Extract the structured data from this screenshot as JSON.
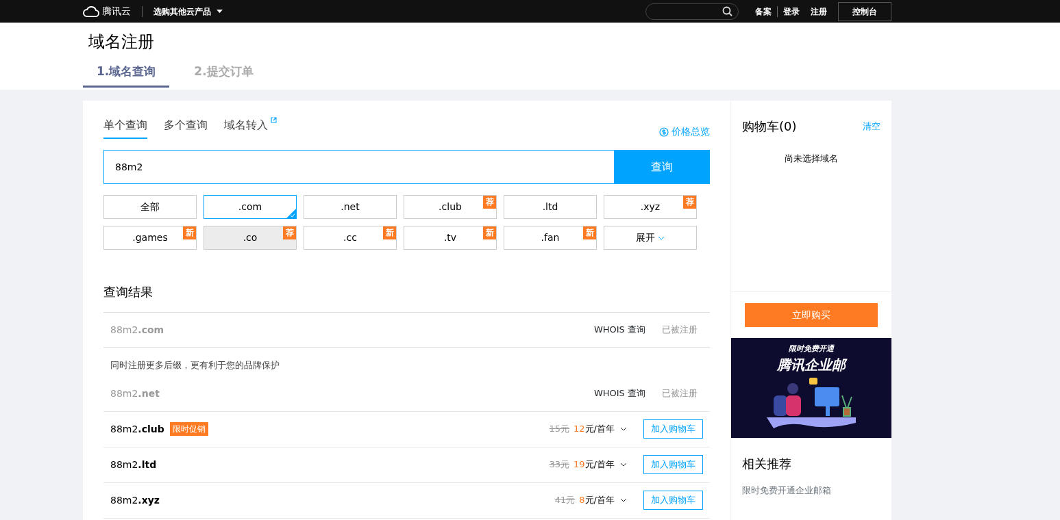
{
  "topbar": {
    "logo_text": "腾讯云",
    "product_menu": "选购其他云产品",
    "links": [
      "备案",
      "登录",
      "注册"
    ],
    "console_button": "控制台"
  },
  "page_title": "域名注册",
  "steps": [
    {
      "label": "1.域名查询",
      "selected": true
    },
    {
      "label": "2.提交订单",
      "selected": false
    }
  ],
  "query_tabs": [
    {
      "label": "单个查询",
      "selected": true,
      "external": false
    },
    {
      "label": "多个查询",
      "selected": false,
      "external": false
    },
    {
      "label": "域名转入",
      "selected": false,
      "external": true
    }
  ],
  "price_overview": "价格总览",
  "search": {
    "value": "88m2",
    "button": "查询"
  },
  "suffixes": [
    {
      "kind": "suffix",
      "label": "全部",
      "selected": false,
      "hovered": false
    },
    {
      "kind": "suffix",
      "label": ".com",
      "selected": true,
      "hovered": false
    },
    {
      "kind": "suffix",
      "label": ".net",
      "selected": false,
      "hovered": false
    },
    {
      "kind": "suffix",
      "label": ".club",
      "selected": false,
      "hovered": false,
      "tag": "荐"
    },
    {
      "kind": "suffix",
      "label": ".ltd",
      "selected": false,
      "hovered": false
    },
    {
      "kind": "suffix",
      "label": ".xyz",
      "selected": false,
      "hovered": false,
      "tag": "荐"
    },
    {
      "kind": "suffix",
      "label": ".games",
      "selected": false,
      "hovered": false,
      "tag": "新"
    },
    {
      "kind": "suffix",
      "label": ".co",
      "selected": false,
      "hovered": true,
      "tag": "荐"
    },
    {
      "kind": "suffix",
      "label": ".cc",
      "selected": false,
      "hovered": false,
      "tag": "新"
    },
    {
      "kind": "suffix",
      "label": ".tv",
      "selected": false,
      "hovered": false,
      "tag": "新"
    },
    {
      "kind": "suffix",
      "label": ".fan",
      "selected": false,
      "hovered": false,
      "tag": "新"
    },
    {
      "kind": "expand",
      "label": "展开"
    }
  ],
  "results_title": "查询结果",
  "results": [
    {
      "kind": "taken",
      "name": "88m2",
      "suffix": ".com",
      "whois": "WHOIS 查询",
      "status": "已被注册"
    },
    {
      "kind": "note",
      "text": "同时注册更多后缀，更有利于您的品牌保护"
    },
    {
      "kind": "taken",
      "name": "88m2",
      "suffix": ".net",
      "whois": "WHOIS 查询",
      "status": "已被注册"
    },
    {
      "kind": "available",
      "name": "88m2",
      "suffix": ".club",
      "promo": "限时促销",
      "old_price": "15元",
      "price": "12",
      "unit": "元/首年",
      "button": "加入购物车"
    },
    {
      "kind": "available",
      "name": "88m2",
      "suffix": ".ltd",
      "old_price": "33元",
      "price": "19",
      "unit": "元/首年",
      "button": "加入购物车"
    },
    {
      "kind": "available",
      "name": "88m2",
      "suffix": ".xyz",
      "old_price": "41元",
      "price": "8",
      "unit": "元/首年",
      "button": "加入购物车"
    }
  ],
  "cart": {
    "title": "购物车(0)",
    "clear": "清空",
    "empty": "尚未选择域名",
    "buy": "立即购买"
  },
  "banner": {
    "subtitle": "限时免费开通",
    "title": "腾讯企业邮"
  },
  "related": {
    "title": "相关推荐",
    "items": [
      "限时免费开通企业邮箱"
    ]
  }
}
